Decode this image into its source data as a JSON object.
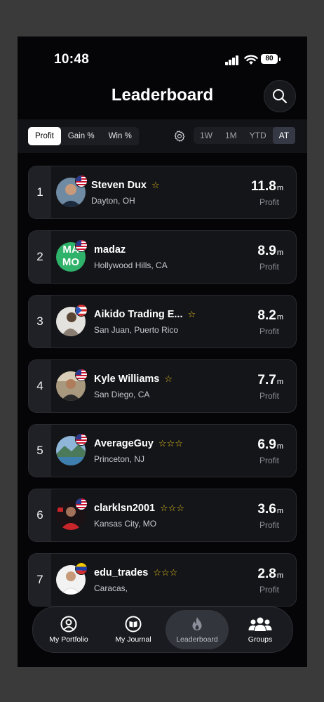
{
  "status": {
    "time": "10:48",
    "battery": "80"
  },
  "header": {
    "title": "Leaderboard"
  },
  "metric_tabs": [
    "Profit",
    "Gain %",
    "Win %"
  ],
  "metric_active": "Profit",
  "period_tabs": [
    "1W",
    "1M",
    "YTD",
    "AT"
  ],
  "period_active": "AT",
  "rows": [
    {
      "rank": "1",
      "name": "Steven Dux",
      "stars": "☆",
      "location": "Dayton, OH",
      "value": "11.8",
      "unit": "m",
      "label": "Profit"
    },
    {
      "rank": "2",
      "name": "madaz",
      "stars": "",
      "location": "Hollywood Hills, CA",
      "value": "8.9",
      "unit": "m",
      "label": "Profit",
      "avatar_text": "MA MO"
    },
    {
      "rank": "3",
      "name": "Aikido Trading E...",
      "stars": "☆",
      "location": "San Juan, Puerto Rico",
      "value": "8.2",
      "unit": "m",
      "label": "Profit"
    },
    {
      "rank": "4",
      "name": "Kyle Williams",
      "stars": "☆",
      "location": "San Diego, CA",
      "value": "7.7",
      "unit": "m",
      "label": "Profit"
    },
    {
      "rank": "5",
      "name": "AverageGuy",
      "stars": "☆☆☆",
      "location": "Princeton, NJ",
      "value": "6.9",
      "unit": "m",
      "label": "Profit"
    },
    {
      "rank": "6",
      "name": "clarklsn2001",
      "stars": "☆☆☆",
      "location": "Kansas City, MO",
      "value": "3.6",
      "unit": "m",
      "label": "Profit"
    },
    {
      "rank": "7",
      "name": "edu_trades",
      "stars": "☆☆☆",
      "location": "Caracas,",
      "value": "2.8",
      "unit": "m",
      "label": "Profit"
    }
  ],
  "nav": [
    {
      "label": "My Portfolio",
      "icon": "user-circle-icon"
    },
    {
      "label": "My Journal",
      "icon": "book-icon"
    },
    {
      "label": "Leaderboard",
      "icon": "flame-icon"
    },
    {
      "label": "Groups",
      "icon": "group-icon"
    }
  ],
  "nav_active": "Leaderboard",
  "colors": {
    "accent_star": "#e8c21a",
    "background": "#050507",
    "card": "#141519"
  }
}
